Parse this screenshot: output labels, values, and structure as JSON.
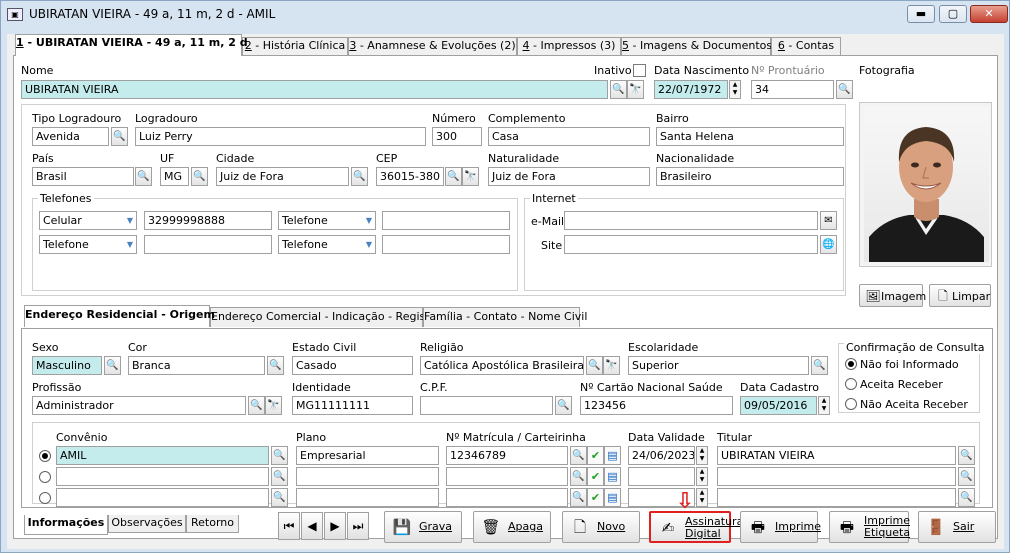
{
  "window": {
    "title": "UBIRATAN VIEIRA - 49 a, 11 m, 2 d - AMIL",
    "min": "▬",
    "max": "▢",
    "close": "✕"
  },
  "tabs": [
    {
      "key": "1",
      "label": " - UBIRATAN VIEIRA - 49 a, 11 m, 2 d"
    },
    {
      "key": "2",
      "label": " - História Clínica"
    },
    {
      "key": "3",
      "label": " - Anamnese & Evoluções  (2)"
    },
    {
      "key": "4",
      "label": " - Impressos  (3)"
    },
    {
      "key": "5",
      "label": " - Imagens & Documentos"
    },
    {
      "key": "6",
      "label": " - Contas"
    }
  ],
  "labels": {
    "nome": "Nome",
    "inativo": "Inativo",
    "data_nascimento": "Data Nascimento",
    "prontuario": "Nº Prontuário",
    "fotografia": "Fotografia",
    "tipo_logradouro": "Tipo Logradouro",
    "logradouro": "Logradouro",
    "numero": "Número",
    "complemento": "Complemento",
    "bairro": "Bairro",
    "pais": "País",
    "uf": "UF",
    "cidade": "Cidade",
    "cep": "CEP",
    "naturalidade": "Naturalidade",
    "nacionalidade": "Nacionalidade",
    "telefones": "Telefones",
    "internet": "Internet",
    "email": "e-Mail",
    "site": "Site",
    "sexo": "Sexo",
    "cor": "Cor",
    "estado_civil": "Estado Civil",
    "religiao": "Religião",
    "escolaridade": "Escolaridade",
    "confirmacao": "Confirmação de Consulta",
    "profissao": "Profissão",
    "identidade": "Identidade",
    "cpf": "C.P.F.",
    "cartao_sus": "Nº Cartão Nacional Saúde",
    "data_cadastro": "Data Cadastro",
    "convenio": "Convênio",
    "plano": "Plano",
    "matricula": "Nº Matrícula / Carteirinha",
    "validade": "Data Validade",
    "titular": "Titular"
  },
  "values": {
    "nome": "UBIRATAN VIEIRA",
    "data_nascimento": "22/07/1972",
    "prontuario": "34",
    "tipo_logradouro": "Avenida",
    "logradouro": "Luiz Perry",
    "numero": "300",
    "complemento": "Casa",
    "bairro": "Santa Helena",
    "pais": "Brasil",
    "uf": "MG",
    "cidade": "Juiz de Fora",
    "cep": "36015-380",
    "naturalidade": "Juiz de Fora",
    "nacionalidade": "Brasileiro",
    "tel1_tipo": "Celular",
    "tel1_numero": "32999998888",
    "tel2_tipo": "Telefone",
    "tel3_tipo": "Telefone",
    "tel4_tipo": "Telefone",
    "email": "",
    "site": "",
    "sexo": "Masculino",
    "cor": "Branca",
    "estado_civil": "Casado",
    "religiao": "Católica Apostólica Brasileira",
    "escolaridade": "Superior",
    "profissao": "Administrador",
    "identidade": "MG11111111",
    "cpf": "",
    "cartao_sus": "123456",
    "data_cadastro": "09/05/2016"
  },
  "photo_buttons": {
    "imagem": "Imagem",
    "limpar": "Limpar"
  },
  "address_tabs": [
    "Endereço Residencial - Origem",
    "Endereço Comercial - Indicação - Registro",
    "Família - Contato - Nome Civil"
  ],
  "confirmacao_options": [
    "Não foi Informado",
    "Aceita Receber",
    "Não Aceita Receber"
  ],
  "convenios": [
    {
      "convenio": "AMIL",
      "plano": "Empresarial",
      "matricula": "12346789",
      "validade": "24/06/2023",
      "titular": "UBIRATAN VIEIRA"
    },
    {
      "convenio": "",
      "plano": "",
      "matricula": "",
      "validade": "",
      "titular": ""
    },
    {
      "convenio": "",
      "plano": "",
      "matricula": "",
      "validade": "",
      "titular": ""
    }
  ],
  "bottom_tabs": [
    "Informações",
    "Observações",
    "Retorno"
  ],
  "actions": {
    "grava": "Grava",
    "apaga": "Apaga",
    "novo": "Novo",
    "assinatura": "Assinatura Digital",
    "imprime": "Imprime",
    "imprime_etiqueta": "Imprime Etiqueta",
    "sair": "Sair"
  },
  "nav": {
    "first": "⏮",
    "prev": "◀",
    "next": "▶",
    "last": "⏭"
  },
  "icons": {
    "search": "🔍",
    "binoculars": "🔭",
    "check": "✔",
    "doc": "▤",
    "spin_up": "▲",
    "spin_down": "▼",
    "dd": "▼",
    "arrow": "⇩"
  },
  "colors": {
    "highlight": "#c4ecec",
    "accent_red": "#e02020"
  }
}
